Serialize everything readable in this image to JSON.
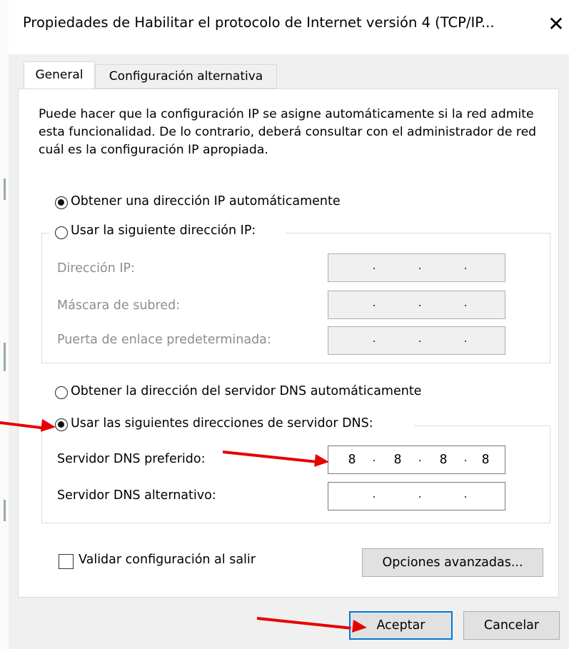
{
  "window": {
    "title": "Propiedades de Habilitar el protocolo de Internet versión 4 (TCP/IP...",
    "close_glyph": "✕"
  },
  "tabs": [
    {
      "label": "General",
      "active": true
    },
    {
      "label": "Configuración alternativa",
      "active": false
    }
  ],
  "description": "Puede hacer que la configuración IP se asigne automáticamente si la red admite esta funcionalidad. De lo contrario, deberá consultar con el administrador de red cuál es la configuración IP apropiada.",
  "ip_section": {
    "auto_label": "Obtener una dirección IP automáticamente",
    "auto_selected": true,
    "manual_label": "Usar la siguiente dirección IP:",
    "manual_selected": false,
    "fields": [
      {
        "label": "Dirección IP:",
        "octets": [
          "",
          "",
          "",
          ""
        ],
        "enabled": false
      },
      {
        "label": "Máscara de subred:",
        "octets": [
          "",
          "",
          "",
          ""
        ],
        "enabled": false
      },
      {
        "label": "Puerta de enlace predeterminada:",
        "octets": [
          "",
          "",
          "",
          ""
        ],
        "enabled": false
      }
    ]
  },
  "dns_section": {
    "auto_label": "Obtener la dirección del servidor DNS automáticamente",
    "auto_selected": false,
    "manual_label": "Usar las siguientes direcciones de servidor DNS:",
    "manual_selected": true,
    "fields": [
      {
        "label": "Servidor DNS preferido:",
        "octets": [
          "8",
          "8",
          "8",
          "8"
        ],
        "enabled": true
      },
      {
        "label": "Servidor DNS alternativo:",
        "octets": [
          "",
          "",
          "",
          ""
        ],
        "enabled": true
      }
    ]
  },
  "validate": {
    "label": "Validar configuración al salir",
    "checked": false
  },
  "buttons": {
    "advanced": "Opciones avanzadas...",
    "ok": "Aceptar",
    "cancel": "Cancelar"
  },
  "annotations": {
    "arrow_color": "#e60000",
    "arrow_count": 3
  },
  "colors": {
    "accent": "#0078d7",
    "dialog_bg": "#f0f0f0",
    "disabled_text": "#8d8d8d"
  }
}
